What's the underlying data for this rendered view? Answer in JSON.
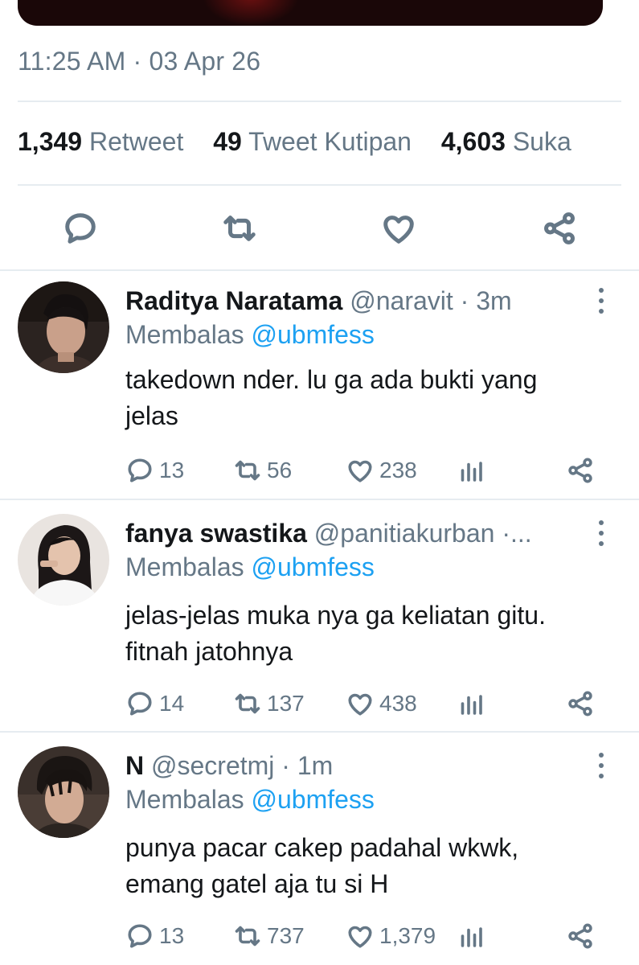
{
  "tweet": {
    "timestamp": "11:25 AM · 03 Apr 26",
    "stats": {
      "retweets_count": "1,349",
      "retweets_label": "Retweet",
      "quotes_count": "49",
      "quotes_label": "Tweet Kutipan",
      "likes_count": "4,603",
      "likes_label": "Suka"
    },
    "actions": [
      "reply-icon",
      "retweet-icon",
      "like-icon",
      "share-icon"
    ]
  },
  "replies": [
    {
      "name": "Raditya Naratama",
      "handle": "@naravit",
      "time": "· 3m",
      "replying_label": "Membalas",
      "replying_to": "@ubmfess",
      "text_line1": "takedown nder. lu ga ada bukti yang",
      "text_line2": "jelas",
      "reply_count": "13",
      "retweet_count": "56",
      "like_count": "238"
    },
    {
      "name": "fanya swastika",
      "handle": "@panitiakurban",
      "time": "·...",
      "replying_label": "Membalas",
      "replying_to": "@ubmfess",
      "text_line1": "jelas-jelas muka nya ga keliatan gitu.",
      "text_line2": "fitnah jatohnya",
      "reply_count": "14",
      "retweet_count": "137",
      "like_count": "438"
    },
    {
      "name": "N",
      "handle": "@secretmj",
      "time": "· 1m",
      "replying_label": "Membalas",
      "replying_to": "@ubmfess",
      "text_line1": "punya pacar cakep padahal wkwk,",
      "text_line2": "emang gatel aja tu si H",
      "reply_count": "13",
      "retweet_count": "737",
      "like_count": "1,379"
    }
  ],
  "colors": {
    "text": "#14171a",
    "muted": "#657786",
    "link": "#1da1f2",
    "divider": "#e6ecf0"
  }
}
